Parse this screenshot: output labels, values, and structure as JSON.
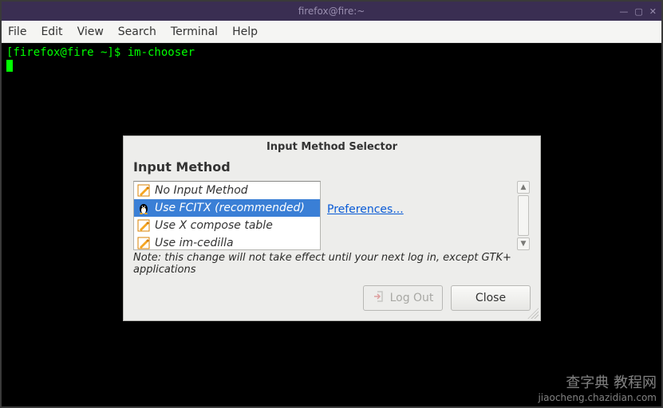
{
  "titlebar": {
    "title": "firefox@fire:~"
  },
  "menubar": {
    "file": "File",
    "edit": "Edit",
    "view": "View",
    "search": "Search",
    "terminal": "Terminal",
    "help": "Help"
  },
  "terminal": {
    "prompt": "[firefox@fire ~]$ ",
    "command": "im-chooser"
  },
  "dialog": {
    "title": "Input Method Selector",
    "section_title": "Input Method",
    "items": [
      {
        "label": "No Input Method"
      },
      {
        "label": "Use FCITX (recommended)"
      },
      {
        "label": "Use X compose table"
      },
      {
        "label": "Use im-cedilla"
      }
    ],
    "preferences_label": "Preferences...",
    "note": "Note: this change will not take effect until your next log in, except GTK+ applications",
    "buttons": {
      "logout": "Log Out",
      "close": "Close"
    }
  },
  "watermark": {
    "line1": "查字典  教程网",
    "line2": "jiaocheng.chazidian.com"
  }
}
